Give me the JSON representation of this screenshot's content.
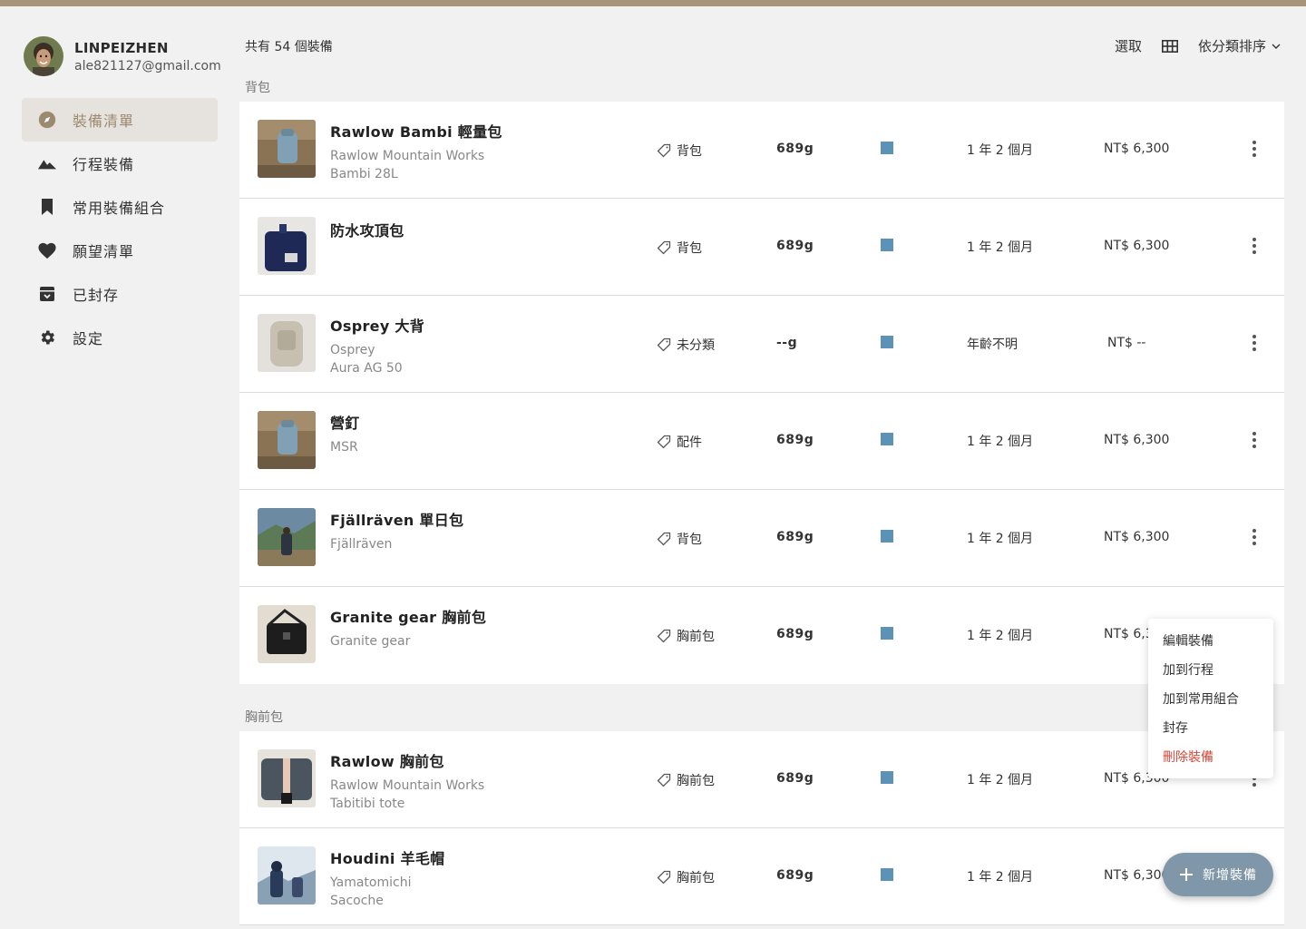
{
  "user": {
    "name": "LINPEIZHEN",
    "email": "ale821127@gmail.com"
  },
  "nav": [
    {
      "label": "裝備清單",
      "icon": "compass-icon",
      "active": true
    },
    {
      "label": "行程裝備",
      "icon": "mountain-icon"
    },
    {
      "label": "常用裝備組合",
      "icon": "bookmark-icon"
    },
    {
      "label": "願望清單",
      "icon": "heart-icon"
    },
    {
      "label": "已封存",
      "icon": "archive-icon"
    },
    {
      "label": "設定",
      "icon": "gear-icon"
    }
  ],
  "header": {
    "count": "共有 54 個裝備",
    "select": "選取",
    "sort": "依分類排序"
  },
  "sections": [
    {
      "title": "背包",
      "items": [
        {
          "name": "Rawlow Bambi 輕量包",
          "sub1": "Rawlow Mountain Works",
          "sub2": "Bambi 28L",
          "category": "背包",
          "weight": "689g",
          "age": "1 年 2 個月",
          "price": "NT$ 6,300"
        },
        {
          "name": "防水攻頂包",
          "sub1": "",
          "sub2": "",
          "category": "背包",
          "weight": "689g",
          "age": "1 年 2 個月",
          "price": "NT$ 6,300"
        },
        {
          "name": "Osprey 大背",
          "sub1": "Osprey",
          "sub2": "Aura AG 50",
          "category": "未分類",
          "weight": "--g",
          "age": "年齡不明",
          "price": "NT$ --"
        },
        {
          "name": "營釘",
          "sub1": "MSR",
          "sub2": "",
          "category": "配件",
          "weight": "689g",
          "age": "1 年 2 個月",
          "price": "NT$ 6,300"
        },
        {
          "name": "Fjällräven 單日包",
          "sub1": "Fjällräven",
          "sub2": "",
          "category": "背包",
          "weight": "689g",
          "age": "1 年 2 個月",
          "price": "NT$ 6,300"
        },
        {
          "name": "Granite gear 胸前包",
          "sub1": "Granite gear",
          "sub2": "",
          "category": "胸前包",
          "weight": "689g",
          "age": "1 年 2 個月",
          "price": "NT$ 6,3"
        }
      ]
    },
    {
      "title": "胸前包",
      "items": [
        {
          "name": "Rawlow 胸前包",
          "sub1": "Rawlow Mountain Works",
          "sub2": "Tabitibi tote",
          "category": "胸前包",
          "weight": "689g",
          "age": "1 年 2 個月",
          "price": "NT$ 6,300"
        },
        {
          "name": "Houdini 羊毛帽",
          "sub1": "Yamatomichi",
          "sub2": "Sacoche",
          "category": "胸前包",
          "weight": "689g",
          "age": "1 年 2 個月",
          "price": "NT$ 6,300"
        }
      ]
    }
  ],
  "menu": {
    "edit": "編輯裝備",
    "add_trip": "加到行程",
    "add_combo": "加到常用組合",
    "archive": "封存",
    "delete": "刪除裝備"
  },
  "fab": {
    "label": "新增裝備"
  },
  "colors": {
    "accent": "#9c8a70",
    "topbar": "#a89579",
    "item_color": "#5b92b5",
    "fab": "#7f97a8",
    "danger": "#d9473a"
  }
}
